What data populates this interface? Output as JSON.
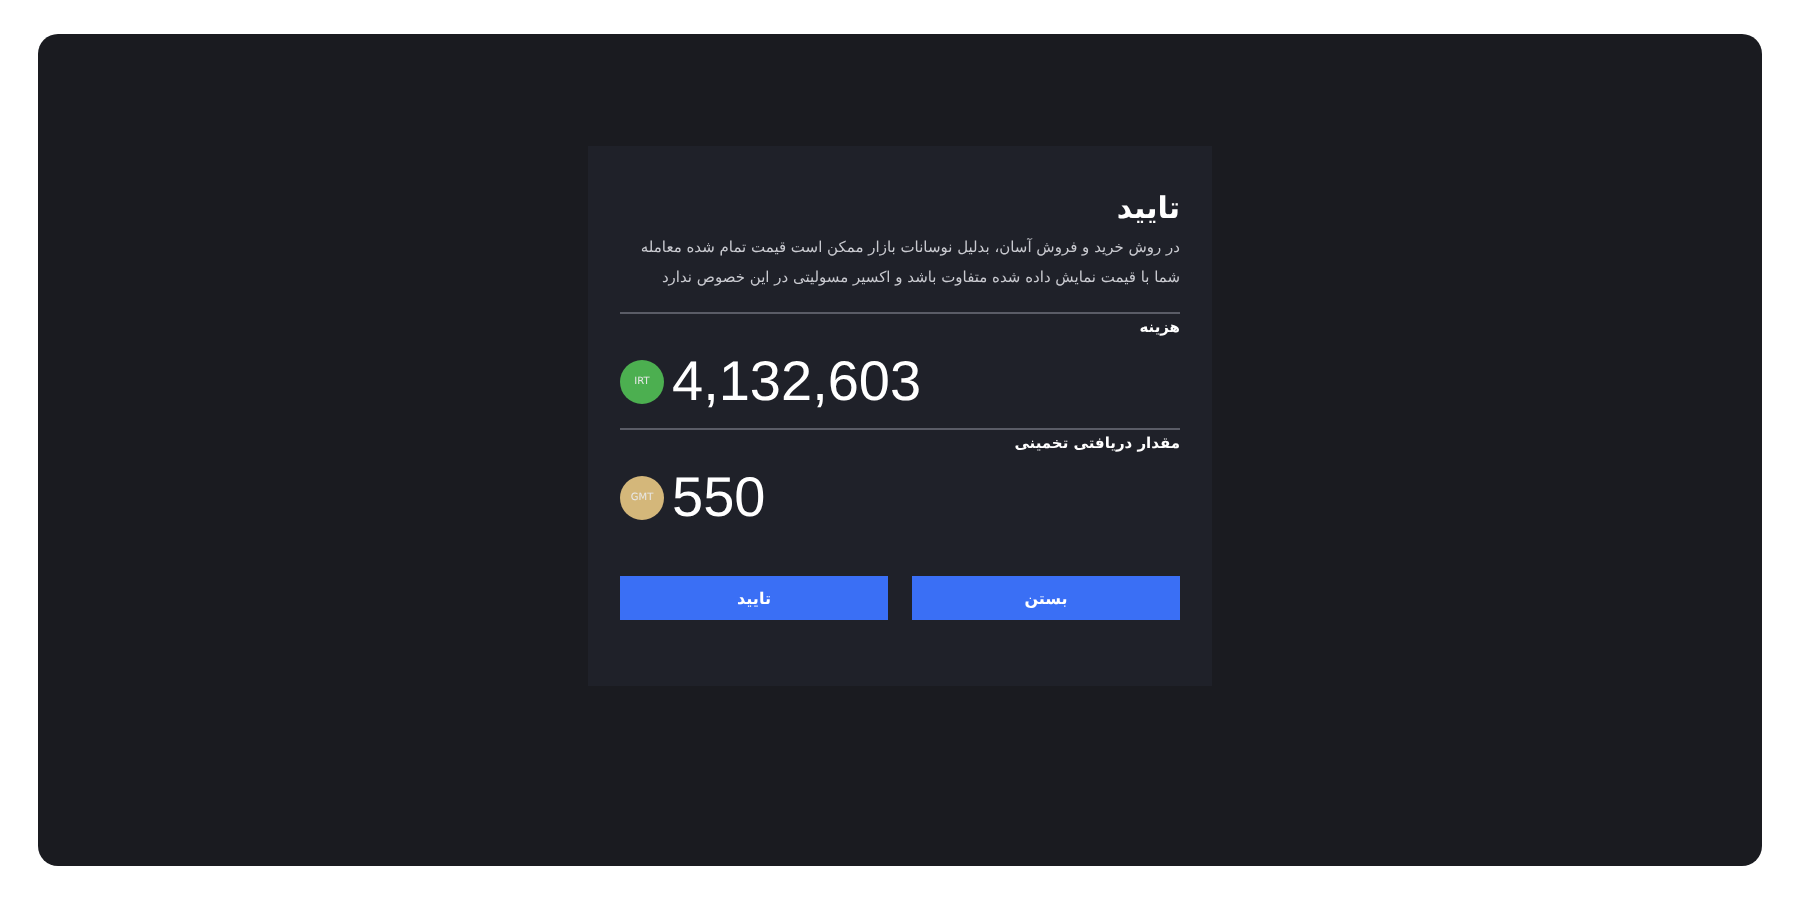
{
  "dialog": {
    "title": "تایید",
    "message": "در روش خرید و فروش آسان، بدلیل نوسانات بازار ممکن است قیمت تمام شده معامله شما با قیمت نمایش داده شده متفاوت باشد و اکسیر مسولیتی در این خصوص ندارد",
    "amounts": [
      {
        "label": "هزینه",
        "badge": "IRT",
        "color": "#4caf50",
        "value": "4,132,603"
      },
      {
        "label": "مقدار دریافتی تخمینی",
        "badge": "GMT",
        "color": "#d4b77a",
        "value": "550"
      }
    ],
    "buttons": [
      "بستن",
      "تایید"
    ]
  }
}
